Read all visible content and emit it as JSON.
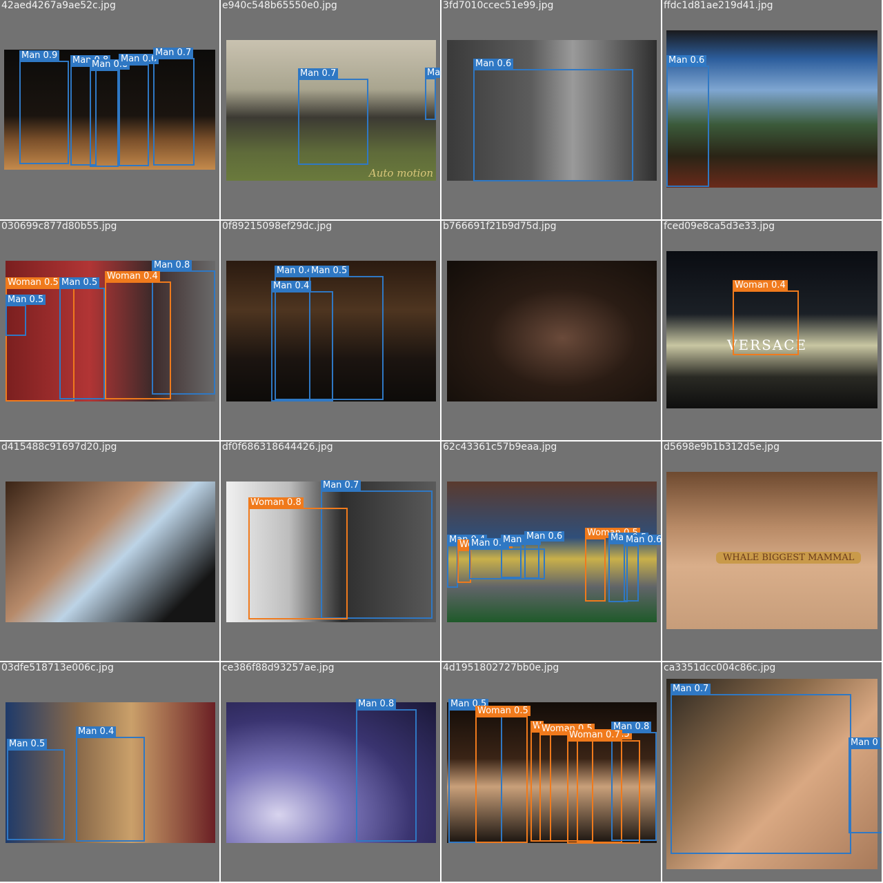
{
  "colors": {
    "man": "#2f78c4",
    "woman": "#f07a1c",
    "tile_bg": "#727272"
  },
  "tiles": [
    {
      "file": "42aed4267a9ae52c.jpg",
      "bg": "linear-gradient(180deg,#0c0b0a 0%,#1a140f 55%,#7a4f2a 75%,#c48a4c 100%)",
      "detections": [
        {
          "label": "Man 0.9",
          "cls": "man"
        },
        {
          "label": "Man 0.8",
          "cls": "man"
        },
        {
          "label": "Man 0.8",
          "cls": "man"
        },
        {
          "label": "Man 0.6",
          "cls": "man"
        },
        {
          "label": "Man 0.7",
          "cls": "man"
        }
      ]
    },
    {
      "file": "e940c548b65550e0.jpg",
      "bg": "linear-gradient(180deg,#c9c2b0 0%,#a9a58f 35%,#3c3a33 55%,#5f6b3a 80%,#6a7a3c 100%)",
      "detections": [
        {
          "label": "Man 0.7",
          "cls": "man"
        },
        {
          "label": "Ma",
          "cls": "man"
        }
      ],
      "watermark": "Auto motion"
    },
    {
      "file": "3fd7010ccec51e99.jpg",
      "bg": "linear-gradient(90deg,#3a3a3a 0%,#5c5c5c 40%,#9a9a9a 60%,#2e2e2e 100%)",
      "detections": [
        {
          "label": "Man 0.6",
          "cls": "man"
        }
      ]
    },
    {
      "file": "ffdc1d81ae219d41.jpg",
      "bg": "linear-gradient(180deg,#1a1a1c 0%,#2c5d9c 18%,#7fa6d1 38%,#3b5a3a 60%,#2a2416 80%,#6a2a1a 100%)",
      "detections": [
        {
          "label": "Man 0.6",
          "cls": "man"
        }
      ]
    },
    {
      "file": "030699c877d80b55.jpg",
      "bg": "linear-gradient(90deg,#7a1f1f 0%,#b23535 40%,#3d2a2a 70%,#6a6a6a 100%)",
      "detections": [
        {
          "label": "Man 0.8",
          "cls": "man"
        },
        {
          "label": "Woman 0.5",
          "cls": "woman"
        },
        {
          "label": "Man 0.5",
          "cls": "man"
        },
        {
          "label": "Woman 0.4",
          "cls": "woman"
        },
        {
          "label": "Man 0.5",
          "cls": "man"
        }
      ]
    },
    {
      "file": "0f89215098ef29dc.jpg",
      "bg": "linear-gradient(180deg,#2a1a10 0%,#4e3520 35%,#1b1410 70%,#0d0b09 100%)",
      "detections": [
        {
          "label": "Man 0.4",
          "cls": "man"
        },
        {
          "label": "Man 0.5",
          "cls": "man"
        },
        {
          "label": "Man 0.4",
          "cls": "man"
        }
      ]
    },
    {
      "file": "b766691f21b9d75d.jpg",
      "bg": "radial-gradient(ellipse at 55% 55%,#6a4a3a 0%,#2a1c14 45%,#120d09 100%)",
      "detections": []
    },
    {
      "file": "fced09e8ca5d3e33.jpg",
      "bg": "linear-gradient(180deg,#0a0c12 0%,#1b2026 40%,#c8c6a2 60%,#2a2a24 80%,#0e0e0e 100%)",
      "detections": [
        {
          "label": "Woman 0.4",
          "cls": "woman"
        }
      ],
      "watermark": "VERSACE"
    },
    {
      "file": "d415488c91697d20.jpg",
      "bg": "linear-gradient(135deg,#3a2416 0%,#b78a6a 40%,#bcd3e6 55%,#151515 85%)",
      "detections": []
    },
    {
      "file": "df0f686318644426.jpg",
      "bg": "linear-gradient(90deg,#f0f0f0 0%,#bdbdbd 30%,#2e2e2e 55%,#5a5a5a 100%)",
      "detections": [
        {
          "label": "Man 0.7",
          "cls": "man"
        },
        {
          "label": "Woman 0.8",
          "cls": "woman"
        }
      ]
    },
    {
      "file": "62c43361c57b9eaa.jpg",
      "bg": "linear-gradient(180deg,#5a3a2e 0%,#2f4f7a 40%,#c9b04a 55%,#606468 75%,#1f5a2a 100%)",
      "detections": [
        {
          "label": "Man 0.4",
          "cls": "man"
        },
        {
          "label": "Woman 0.4",
          "cls": "woman"
        },
        {
          "label": "Man 0.4",
          "cls": "man"
        },
        {
          "label": "Man 0.5",
          "cls": "man"
        },
        {
          "label": "Man 0.6",
          "cls": "man"
        },
        {
          "label": "Woman 0.5",
          "cls": "woman"
        },
        {
          "label": "Man 0.5",
          "cls": "man"
        },
        {
          "label": "Man 0.6",
          "cls": "man"
        }
      ]
    },
    {
      "file": "d5698e9b1b312d5e.jpg",
      "bg": "linear-gradient(180deg,#6e4a30 0%,#b88a66 35%,#d9ae8a 60%,#c79d7a 100%)",
      "detections": [],
      "watermark": "WHALE  BIGGEST MAMMAL"
    },
    {
      "file": "03dfe518713e006c.jpg",
      "bg": "linear-gradient(90deg,#1e3a6a 0%,#8a6a4a 35%,#caa06a 60%,#6a1f24 100%)",
      "detections": [
        {
          "label": "Man 0.4",
          "cls": "man"
        },
        {
          "label": "Man 0.5",
          "cls": "man"
        }
      ]
    },
    {
      "file": "ce386f88d93257ae.jpg",
      "bg": "radial-gradient(ellipse at 25% 80%,#d8d4ee 0%,#7a74b8 30%,#3a3470 60%,#1a1838 100%)",
      "detections": [
        {
          "label": "Man 0.8",
          "cls": "man"
        }
      ]
    },
    {
      "file": "4d1951802727bb0e.jpg",
      "bg": "linear-gradient(180deg,#120c08 0%,#3a2416 40%,#c9a07a 60%,#1a1410 100%)",
      "detections": [
        {
          "label": "Man 0.5",
          "cls": "man"
        },
        {
          "label": "Woman 0.5",
          "cls": "woman"
        },
        {
          "label": "W",
          "cls": "woman"
        },
        {
          "label": "Woman 0.5",
          "cls": "woman"
        },
        {
          "label": "Woman 0.5",
          "cls": "woman"
        },
        {
          "label": "Man 0.8",
          "cls": "man"
        },
        {
          "label": "Woman 0.7",
          "cls": "woman"
        }
      ]
    },
    {
      "file": "ca3351dcc004c86c.jpg",
      "bg": "linear-gradient(135deg,#2a2620 0%,#8a6a4a 35%,#d9a882 60%,#a87a5a 100%)",
      "detections": [
        {
          "label": "Man 0.7",
          "cls": "man"
        },
        {
          "label": "Man 0",
          "cls": "man"
        }
      ]
    }
  ]
}
